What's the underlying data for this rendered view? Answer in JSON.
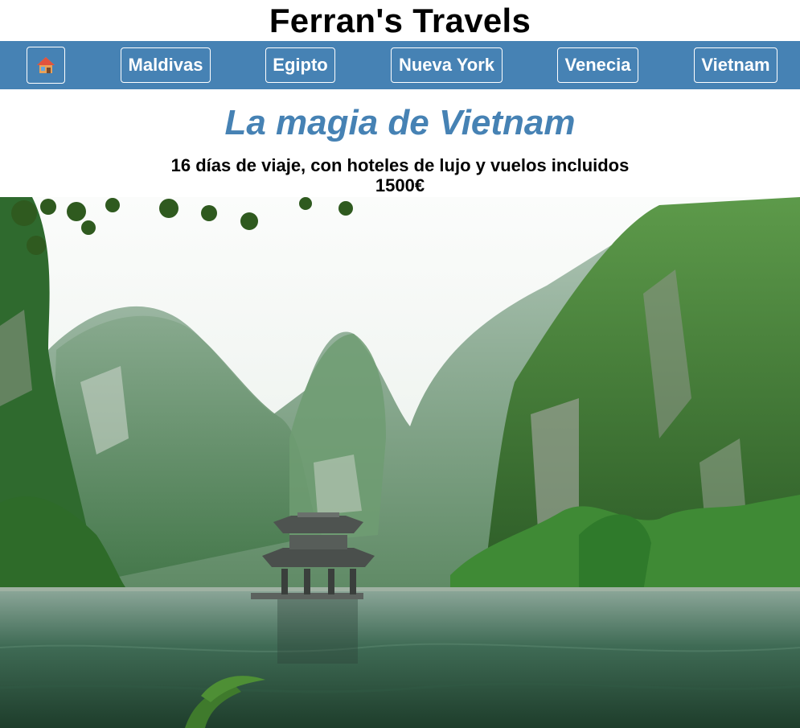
{
  "site": {
    "title": "Ferran's Travels"
  },
  "nav": {
    "home_icon": "house-icon",
    "items": [
      {
        "label": "Maldivas"
      },
      {
        "label": "Egipto"
      },
      {
        "label": "Nueva York"
      },
      {
        "label": "Venecia"
      },
      {
        "label": "Vietnam"
      }
    ]
  },
  "main": {
    "title": "La magia de Vietnam",
    "description": "16 días de viaje, con hoteles de lujo y vuelos incluidos",
    "price": "1500€"
  },
  "colors": {
    "nav_bg": "#4682b4",
    "title": "#4682b4"
  }
}
